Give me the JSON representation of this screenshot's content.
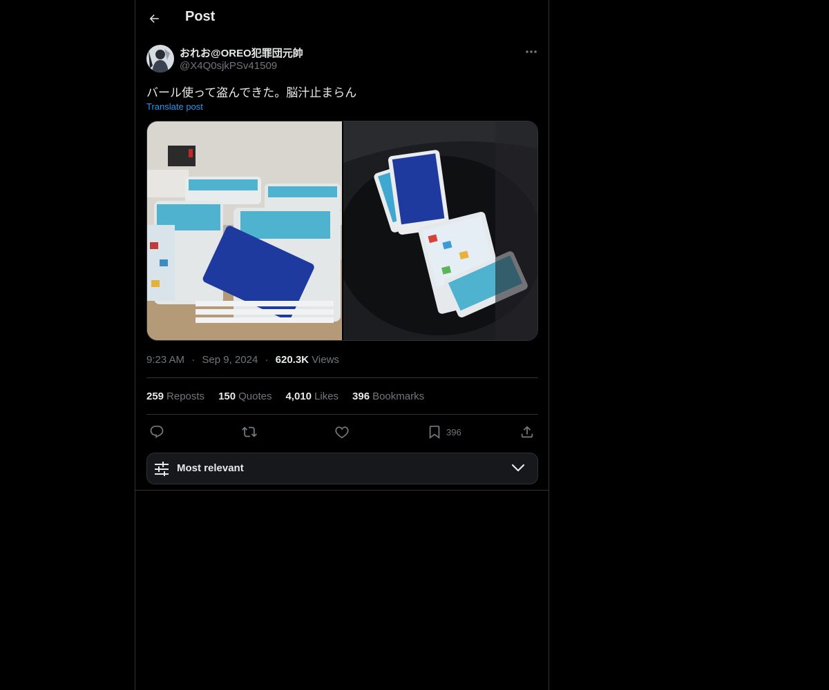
{
  "header": {
    "title": "Post"
  },
  "post": {
    "author": {
      "display_name": "おれお@OREO犯罪団元帥",
      "handle": "@X4Q0sjkPSv41509"
    },
    "text": "バール使って盗んできた。脳汁止まらん",
    "translate_label": "Translate post",
    "time": "9:23 AM",
    "separator": "·",
    "date": "Sep 9, 2024",
    "views_count": "620.3K",
    "views_label": "Views"
  },
  "stats": {
    "reposts": {
      "count": "259",
      "label": "Reposts"
    },
    "quotes": {
      "count": "150",
      "label": "Quotes"
    },
    "likes": {
      "count": "4,010",
      "label": "Likes"
    },
    "bookmarks": {
      "count": "396",
      "label": "Bookmarks"
    }
  },
  "actions": {
    "bookmark_count": "396"
  },
  "sort": {
    "label": "Most relevant"
  },
  "icons": {
    "back": "arrow-left-icon",
    "more": "more-horizontal-icon",
    "reply": "reply-icon",
    "repost": "repost-icon",
    "like": "heart-icon",
    "bookmark": "bookmark-icon",
    "share": "share-icon",
    "sort": "sliders-icon",
    "chevron": "chevron-down-icon"
  },
  "colors": {
    "background": "#000000",
    "text": "#e7e9ea",
    "muted": "#71767b",
    "accent": "#1d9bf0",
    "border": "#2f3336"
  }
}
